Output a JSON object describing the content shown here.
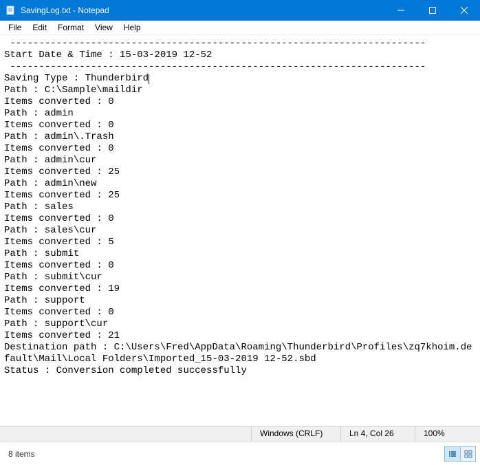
{
  "titlebar": {
    "title": "SavingLog.txt - Notepad"
  },
  "menu": {
    "file": "File",
    "edit": "Edit",
    "format": "Format",
    "view": "View",
    "help": "Help"
  },
  "content": {
    "sep_top": " ------------------------------------------------------------------------",
    "start_line": "Start Date & Time : 15-03-2019 12-52",
    "sep_mid": " ------------------------------------------------------------------------",
    "saving_type": "Saving Type : Thunderbird",
    "lines": [
      "Path : C:\\Sample\\maildir",
      "Items converted : 0",
      "Path : admin",
      "Items converted : 0",
      "Path : admin\\.Trash",
      "Items converted : 0",
      "Path : admin\\cur",
      "Items converted : 25",
      "Path : admin\\new",
      "Items converted : 25",
      "Path : sales",
      "Items converted : 0",
      "Path : sales\\cur",
      "Items converted : 5",
      "Path : submit",
      "Items converted : 0",
      "Path : submit\\cur",
      "Items converted : 19",
      "Path : support",
      "Items converted : 0",
      "Path : support\\cur",
      "Items converted : 21",
      "Destination path : C:\\Users\\Fred\\AppData\\Roaming\\Thunderbird\\Profiles\\zq7khoim.default\\Mail\\Local Folders\\Imported_15-03-2019 12-52.sbd",
      "Status : Conversion completed successfully"
    ]
  },
  "status": {
    "encoding": "Windows (CRLF)",
    "position": "Ln 4, Col 26",
    "zoom": "100%"
  },
  "bottom": {
    "items_label": "8 items"
  }
}
